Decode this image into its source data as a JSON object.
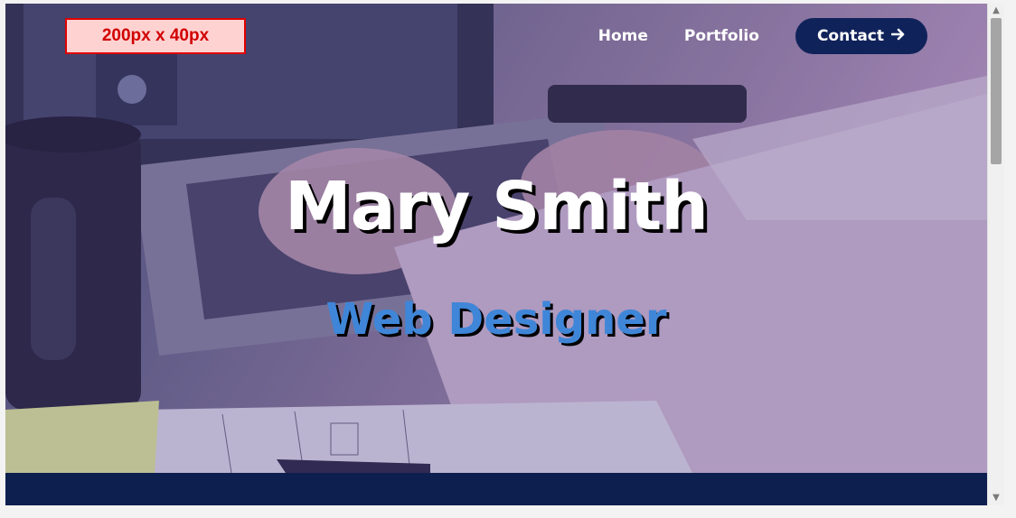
{
  "header": {
    "logo_placeholder_text": "200px x 40px",
    "nav": {
      "home": "Home",
      "portfolio": "Portfolio",
      "contact": "Contact",
      "contact_icon": "arrow-right-icon"
    }
  },
  "hero": {
    "title": "Mary Smith",
    "subtitle": "Web Designer"
  },
  "colors": {
    "logo_border": "#e00000",
    "logo_text": "#d10000",
    "logo_background": "#ffd2d2",
    "nav_button": "#10225a",
    "subtitle": "#3f86d8",
    "footer_band": "#0d1f4f"
  }
}
